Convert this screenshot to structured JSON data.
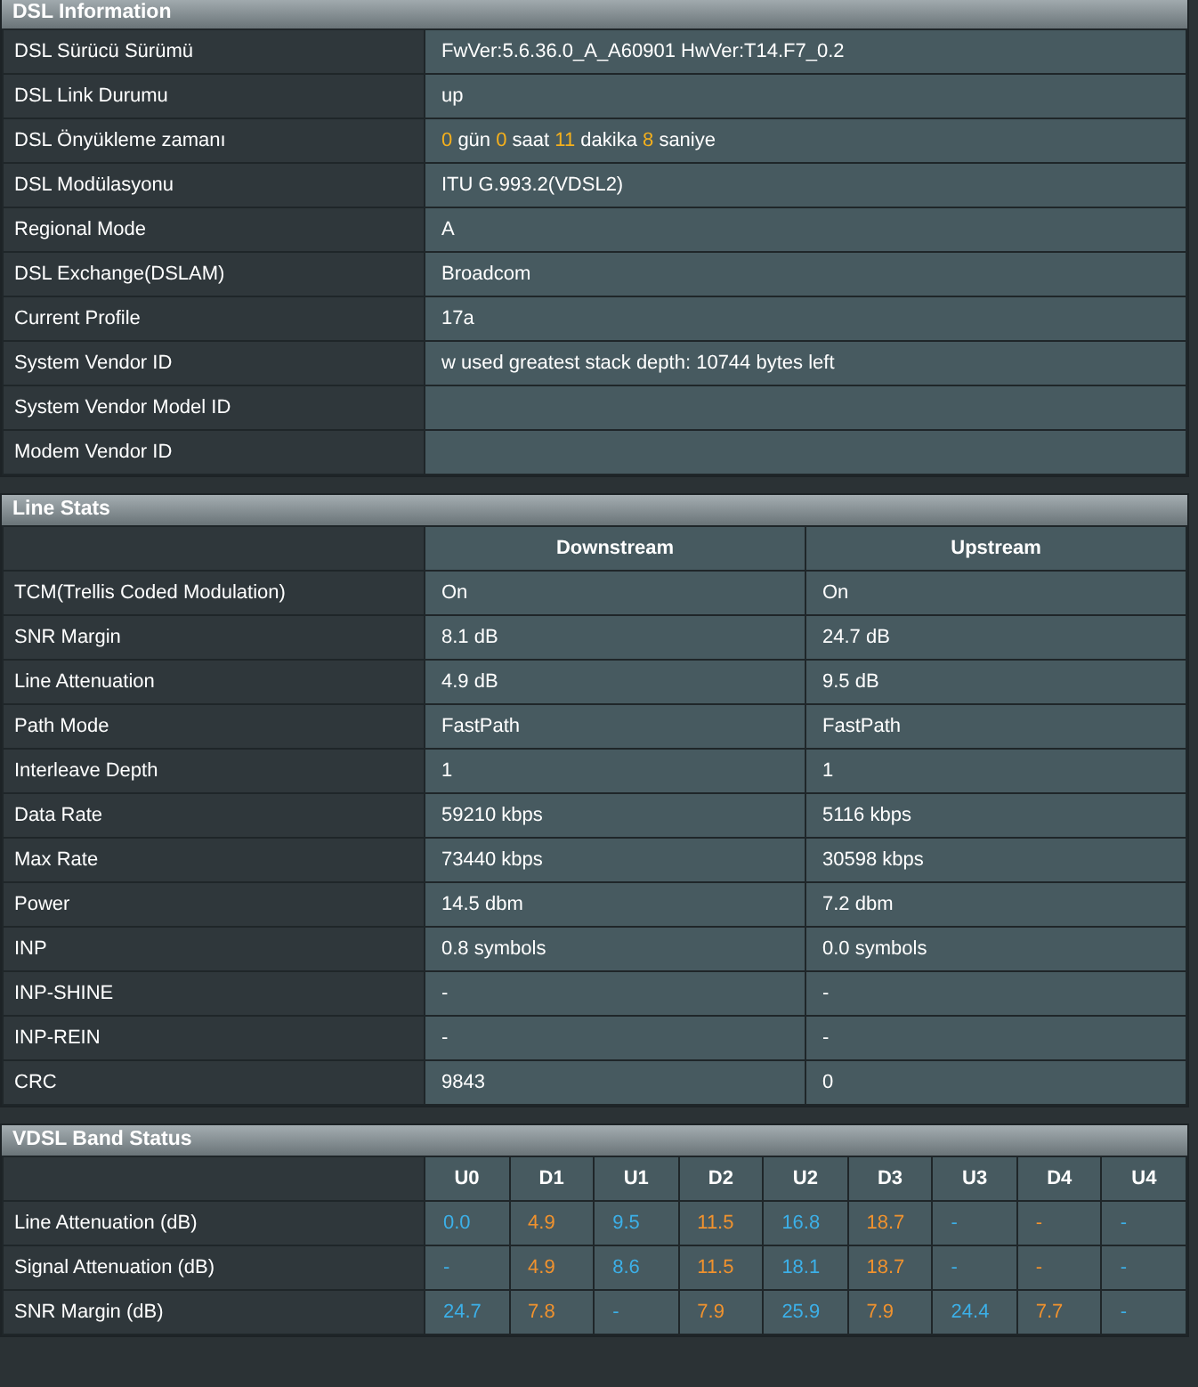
{
  "dsl_information": {
    "title": "DSL Information",
    "rows": [
      {
        "label": "DSL Sürücü Sürümü",
        "value": "FwVer:5.6.36.0_A_A60901 HwVer:T14.F7_0.2"
      },
      {
        "label": "DSL Link Durumu",
        "value": "up"
      },
      {
        "label": "DSL Önyükleme zamanı",
        "parts": [
          {
            "kind": "number",
            "text": "0"
          },
          {
            "kind": "word",
            "text": "gün"
          },
          {
            "kind": "number",
            "text": "0"
          },
          {
            "kind": "word",
            "text": "saat"
          },
          {
            "kind": "number",
            "text": "11"
          },
          {
            "kind": "word",
            "text": "dakika"
          },
          {
            "kind": "number",
            "text": "8"
          },
          {
            "kind": "word",
            "text": "saniye"
          }
        ]
      },
      {
        "label": "DSL Modülasyonu",
        "value": "ITU G.993.2(VDSL2)"
      },
      {
        "label": "Regional Mode",
        "value": "A"
      },
      {
        "label": "DSL Exchange(DSLAM)",
        "value": "Broadcom"
      },
      {
        "label": "Current Profile",
        "value": "17a"
      },
      {
        "label": "System Vendor ID",
        "value": "w used greatest stack depth: 10744 bytes left"
      },
      {
        "label": "System Vendor Model ID"
      },
      {
        "label": "Modem Vendor ID"
      }
    ]
  },
  "line_stats": {
    "title": "Line Stats",
    "columns": [
      "Downstream",
      "Upstream"
    ],
    "rows": [
      {
        "label": "TCM(Trellis Coded Modulation)",
        "values": [
          "On",
          "On"
        ]
      },
      {
        "label": "SNR Margin",
        "values": [
          "8.1 dB",
          "24.7 dB"
        ]
      },
      {
        "label": "Line Attenuation",
        "values": [
          "4.9 dB",
          "9.5 dB"
        ]
      },
      {
        "label": "Path Mode",
        "values": [
          "FastPath",
          "FastPath"
        ]
      },
      {
        "label": "Interleave Depth",
        "values": [
          "1",
          "1"
        ]
      },
      {
        "label": "Data Rate",
        "values": [
          "59210 kbps",
          "5116 kbps"
        ]
      },
      {
        "label": "Max Rate",
        "values": [
          "73440 kbps",
          "30598 kbps"
        ]
      },
      {
        "label": "Power",
        "values": [
          "14.5 dbm",
          "7.2 dbm"
        ]
      },
      {
        "label": "INP",
        "values": [
          "0.8 symbols",
          "0.0 symbols"
        ]
      },
      {
        "label": "INP-SHINE",
        "values": [
          "-",
          "-"
        ]
      },
      {
        "label": "INP-REIN",
        "values": [
          "-",
          "-"
        ]
      },
      {
        "label": "CRC",
        "values": [
          "9843",
          "0"
        ]
      }
    ]
  },
  "vdsl_band_status": {
    "title": "VDSL Band Status",
    "columns": [
      {
        "label": "U0",
        "color": "#3cb0e8"
      },
      {
        "label": "D1",
        "color": "#f0922e"
      },
      {
        "label": "U1",
        "color": "#3cb0e8"
      },
      {
        "label": "D2",
        "color": "#f0922e"
      },
      {
        "label": "U2",
        "color": "#3cb0e8"
      },
      {
        "label": "D3",
        "color": "#f0922e"
      },
      {
        "label": "U3",
        "color": "#3cb0e8"
      },
      {
        "label": "D4",
        "color": "#f0922e"
      },
      {
        "label": "U4",
        "color": "#3cb0e8"
      }
    ],
    "rows": [
      {
        "label": "Line Attenuation (dB)",
        "values": [
          "0.0",
          "4.9",
          "9.5",
          "11.5",
          "16.8",
          "18.7",
          "-",
          "-",
          "-"
        ]
      },
      {
        "label": "Signal Attenuation (dB)",
        "values": [
          "-",
          "4.9",
          "8.6",
          "11.5",
          "18.1",
          "18.7",
          "-",
          "-",
          "-"
        ]
      },
      {
        "label": "SNR Margin (dB)",
        "values": [
          "24.7",
          "7.8",
          "-",
          "7.9",
          "25.9",
          "7.9",
          "24.4",
          "7.7",
          "-"
        ]
      }
    ]
  }
}
